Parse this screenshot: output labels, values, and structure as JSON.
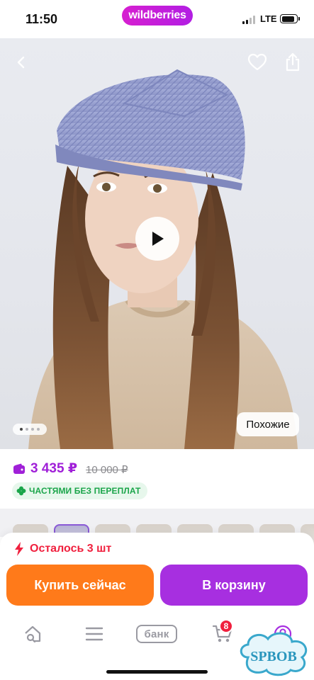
{
  "status_bar": {
    "time": "11:50",
    "brand": "wildberries",
    "network": "LTE",
    "battery_level": 0.85
  },
  "hero": {
    "pager": {
      "count": 4,
      "active_index": 0
    },
    "similar_label": "Похожие"
  },
  "price": {
    "current": "3 435 ₽",
    "old": "10 000 ₽",
    "installments": "ЧАСТЯМИ БЕЗ ПЕРЕПЛАТ"
  },
  "thumbnails": {
    "count": 8,
    "selected_index": 1
  },
  "purchase": {
    "stock_text": "Осталось 3 шт",
    "buy_now_label": "Купить сейчас",
    "add_to_cart_label": "В корзину"
  },
  "tabbar": {
    "bank_label": "банк",
    "cart_count": "8"
  },
  "watermark": {
    "text": "SPBOB"
  },
  "colors": {
    "brand": "#c01fe0",
    "price": "#a020d8",
    "buy_now": "#ff7a1a",
    "add_to_cart": "#a72fe0",
    "alert": "#f0203e",
    "installments": "#1ba54a"
  }
}
